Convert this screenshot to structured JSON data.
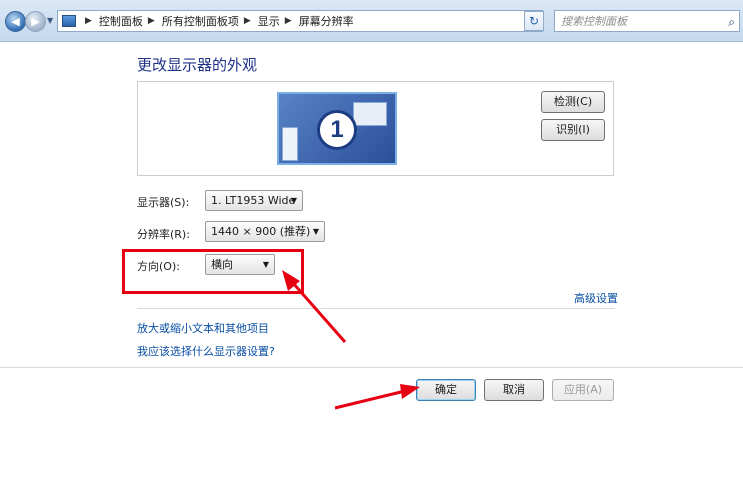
{
  "address_bar": {
    "breadcrumbs": [
      "控制面板",
      "所有控制面板项",
      "显示",
      "屏幕分辨率"
    ],
    "search_placeholder": "搜索控制面板"
  },
  "main": {
    "heading": "更改显示器的外观",
    "monitor_number": "1",
    "detect_button": "检测(C)",
    "identify_button": "识别(I)",
    "display_label": "显示器(S):",
    "display_value": "1. LT1953 Wide",
    "resolution_label": "分辨率(R):",
    "resolution_value": "1440 × 900 (推荐)",
    "orientation_label": "方向(O):",
    "orientation_value": "横向",
    "advanced_link": "高级设置",
    "text_size_link": "放大或缩小文本和其他项目",
    "help_link": "我应该选择什么显示器设置?"
  },
  "footer": {
    "ok_button": "确定",
    "cancel_button": "取消",
    "apply_button": "应用(A)"
  },
  "colors": {
    "annotation": "#e60012",
    "heading": "#1e3287",
    "link": "#0a4fa3"
  }
}
